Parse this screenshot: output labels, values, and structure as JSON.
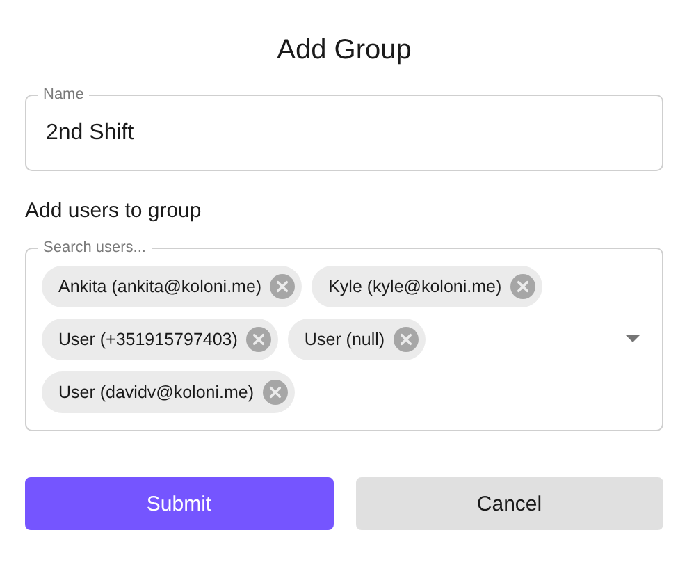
{
  "title": "Add Group",
  "name_field": {
    "label": "Name",
    "value": "2nd Shift"
  },
  "users_heading": "Add users to group",
  "users_field": {
    "label": "Search users...",
    "chips": [
      {
        "label": "Ankita (ankita@koloni.me)"
      },
      {
        "label": "Kyle (kyle@koloni.me)"
      },
      {
        "label": "User (+351915797403)"
      },
      {
        "label": "User (null)"
      },
      {
        "label": "User (davidv@koloni.me)"
      }
    ]
  },
  "buttons": [
    {
      "label": "Submit",
      "kind": "primary"
    },
    {
      "label": "Cancel",
      "kind": "secondary"
    }
  ]
}
